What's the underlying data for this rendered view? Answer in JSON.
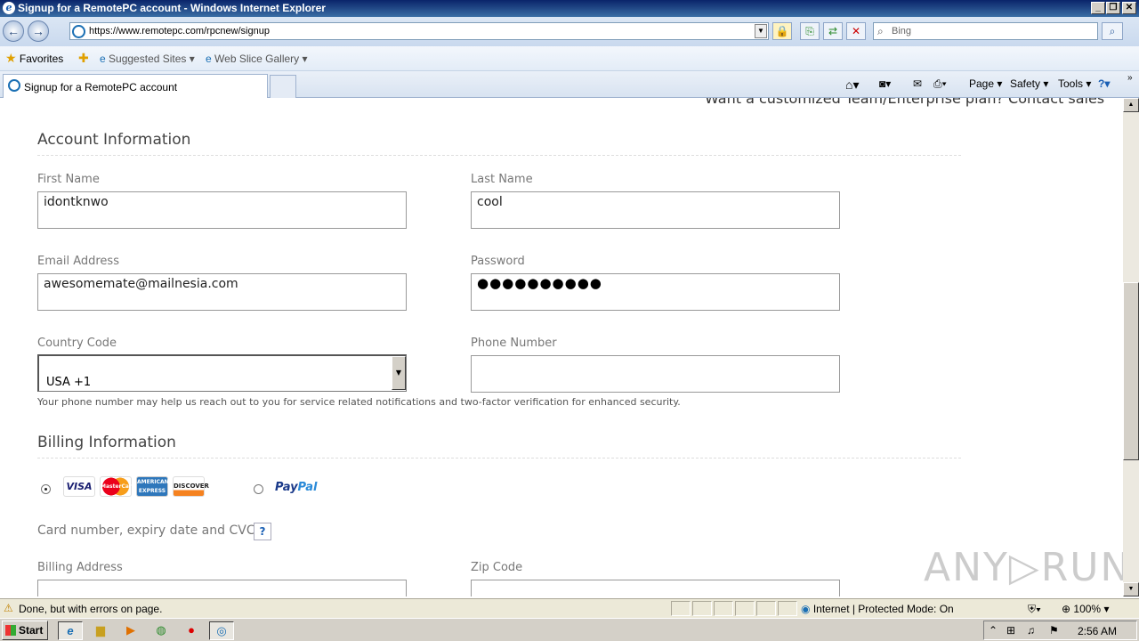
{
  "window": {
    "title": "Signup for a RemotePC account - Windows Internet Explorer",
    "minimize": "_",
    "restore": "❐",
    "close": "✕"
  },
  "address_bar": {
    "url": "https://www.remotepc.com/rpcnew/signup",
    "search_placeholder": "Bing"
  },
  "favorites_bar": {
    "favorites_label": "Favorites",
    "suggested_sites": "Suggested Sites ▾",
    "web_slice_gallery": "Web Slice Gallery ▾"
  },
  "tabs": [
    {
      "label": "Signup for a RemotePC account"
    }
  ],
  "command_bar": {
    "page": "Page ▾",
    "safety": "Safety ▾",
    "tools": "Tools ▾",
    "help": "?▾"
  },
  "page": {
    "cutoff_text": "Want a customized Team/Enterprise plan? Contact sales",
    "account_section_title": "Account Information",
    "first_name_label": "First Name",
    "first_name_value": "idontknwo",
    "last_name_label": "Last Name",
    "last_name_value": "cool",
    "email_label": "Email Address",
    "email_value": "awesomemate@mailnesia.com",
    "password_label": "Password",
    "password_value": "●●●●●●●●●●",
    "country_code_label": "Country Code",
    "country_code_value": "USA +1",
    "phone_label": "Phone Number",
    "phone_value": "",
    "phone_note": "Your phone number may help us reach out to you for service related notifications and two-factor verification for enhanced security.",
    "billing_section_title": "Billing Information",
    "card_brands": [
      "VISA",
      "MasterCard",
      "AMERICAN EXPRESS",
      "DISCOVER"
    ],
    "paypal_pay": "Pay",
    "paypal_pal": "Pal",
    "card_details_label": "Card number, expiry date and CVC",
    "help_button": "?",
    "billing_address_label": "Billing Address",
    "zip_code_label": "Zip Code",
    "watermark": "ANY▷RUN"
  },
  "status_bar": {
    "message": "Done, but with errors on page.",
    "zone": "Internet | Protected Mode: On",
    "zoom": "100%"
  },
  "taskbar": {
    "start_label": "Start",
    "clock": "2:56 AM"
  }
}
